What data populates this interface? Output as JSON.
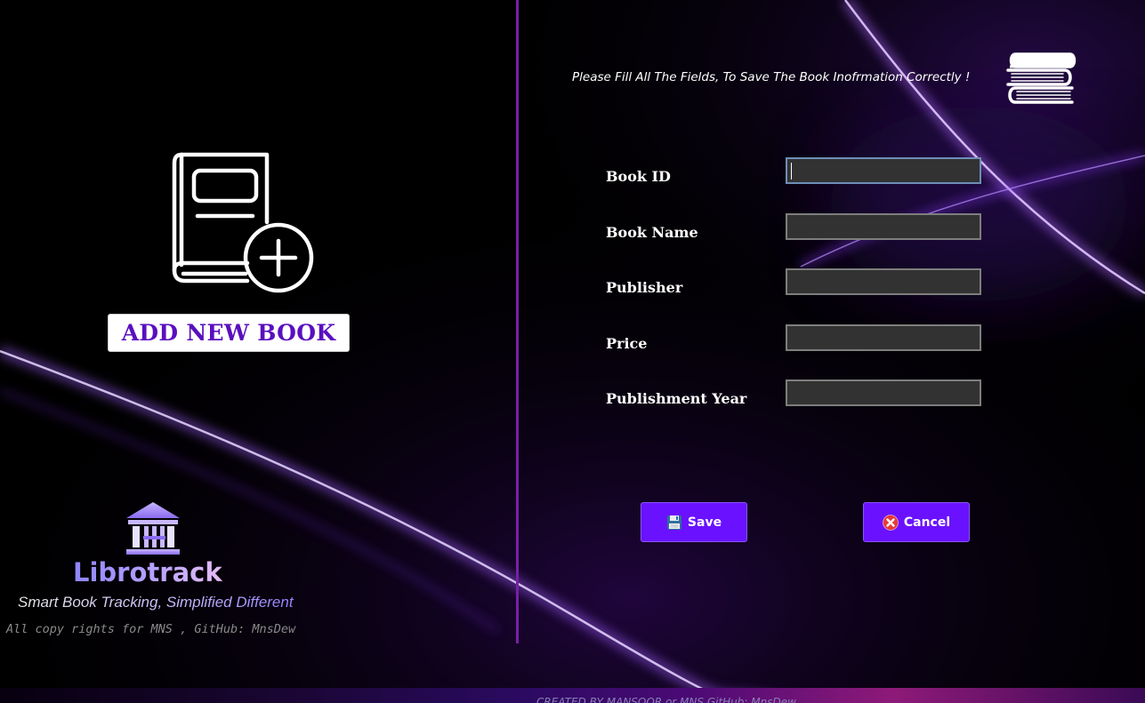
{
  "left_panel": {
    "title": "ADD NEW BOOK",
    "icon": "book-add-icon"
  },
  "branding": {
    "logo_icon": "library-icon",
    "app_name": "Librotrack",
    "tagline": "Smart Book Tracking, Simplified Different",
    "copyright": "All copy rights for MNS , GitHub: MnsDew"
  },
  "form": {
    "instructions": "Please Fill All The Fields, To Save The Book Inofrmation Correctly !",
    "header_icon": "books-stack-icon",
    "fields": [
      {
        "label": "Book ID",
        "value": ""
      },
      {
        "label": "Book Name",
        "value": ""
      },
      {
        "label": "Publisher",
        "value": ""
      },
      {
        "label": "Price",
        "value": ""
      },
      {
        "label": "Publishment Year",
        "value": ""
      }
    ],
    "save_label": "Save",
    "save_icon": "floppy-disk-icon",
    "cancel_label": "Cancel",
    "cancel_icon": "cancel-x-icon"
  },
  "footer": {
    "text": "CREATED BY MANSOOR or MNS GitHub: MnsDew"
  },
  "colors": {
    "accent": "#6a12ff",
    "divider": "#7a1fa8",
    "title_text": "#5a0fbf",
    "input_bg": "#323232"
  }
}
